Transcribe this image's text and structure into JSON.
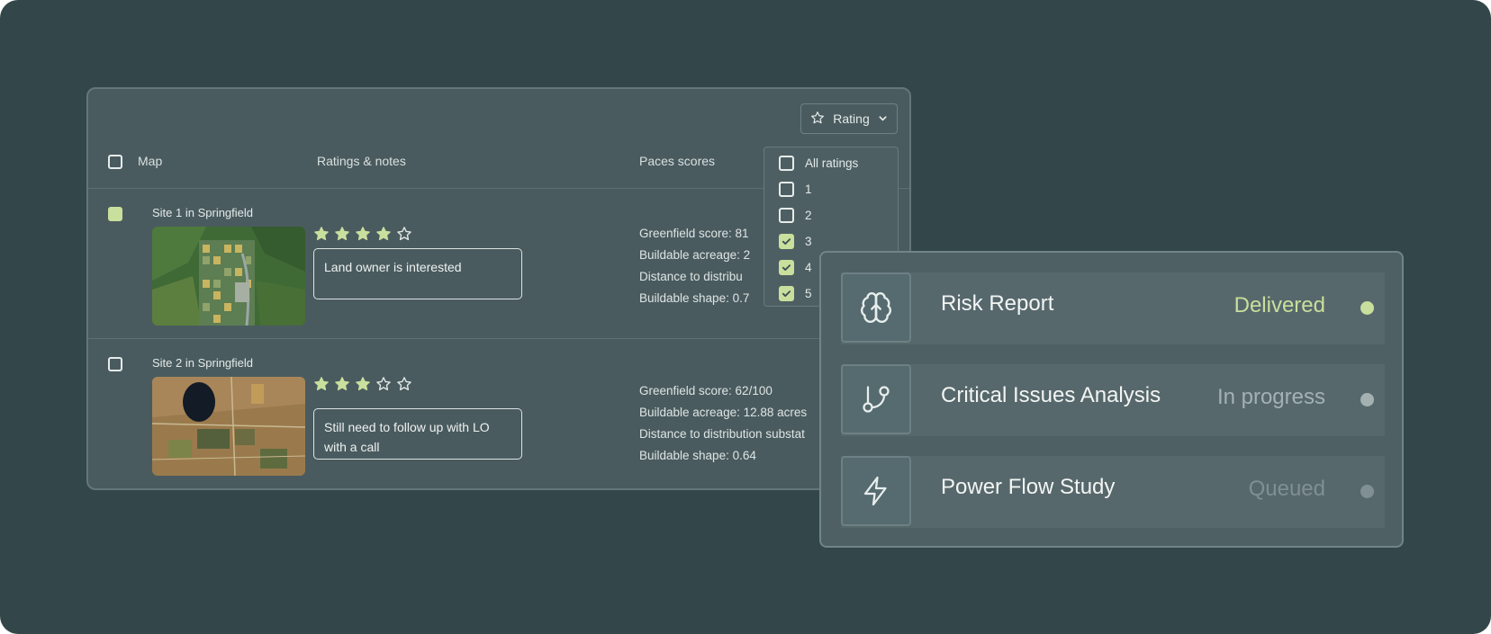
{
  "colors": {
    "background": "#33474a",
    "panel": "#4a5b5f",
    "accent": "#c9df9d",
    "star_empty": "#e3eae9"
  },
  "filter": {
    "label": "Rating",
    "icon": "star-icon",
    "chevron": "chevron-down-icon"
  },
  "table": {
    "headers": {
      "map": "Map",
      "ratings": "Ratings & notes",
      "scores": "Paces scores"
    },
    "select_all_checked": false,
    "sites": [
      {
        "title": "Site 1 in Springfield",
        "checked": true,
        "rating": 4,
        "max_rating": 5,
        "note": "Land owner is interested",
        "scores": [
          "Greenfield score: 81",
          "Buildable acreage: 2",
          "Distance to distribu",
          "Buildable shape: 0.7"
        ]
      },
      {
        "title": "Site 2 in Springfield",
        "checked": false,
        "rating": 3,
        "max_rating": 5,
        "note": "Still need to follow up with LO with a call",
        "scores": [
          "Greenfield score: 62/100",
          "Buildable acreage: 12.88 acres",
          "Distance to distribution substat",
          "Buildable shape: 0.64"
        ]
      }
    ]
  },
  "rating_dropdown": {
    "options": [
      {
        "label": "All ratings",
        "checked": false
      },
      {
        "label": "1",
        "checked": false
      },
      {
        "label": "2",
        "checked": false
      },
      {
        "label": "3",
        "checked": true
      },
      {
        "label": "4",
        "checked": true
      },
      {
        "label": "5",
        "checked": true
      }
    ]
  },
  "reports": [
    {
      "name": "Risk Report",
      "status": "Delivered",
      "icon": "brain-icon",
      "status_color": "#c9df9d",
      "dot_color": "#c9df9d"
    },
    {
      "name": "Critical Issues Analysis",
      "status": "In progress",
      "icon": "git-branch-icon",
      "status_color": "#a3b1b3",
      "dot_color": "#a3b1b3"
    },
    {
      "name": "Power Flow Study",
      "status": "Queued",
      "icon": "lightning-icon",
      "status_color": "#7f8f92",
      "dot_color": "#7f8f92"
    }
  ]
}
